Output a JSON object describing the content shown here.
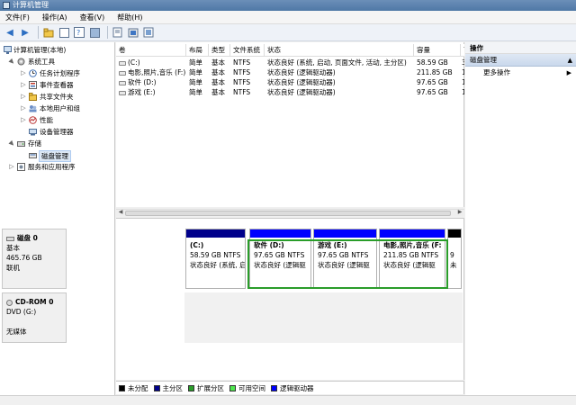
{
  "window": {
    "title": "计算机管理"
  },
  "menu": [
    "文件(F)",
    "操作(A)",
    "查看(V)",
    "帮助(H)"
  ],
  "tree": [
    {
      "label": "计算机管理(本地)",
      "indent": 0,
      "expander": "",
      "icon": "computer-icon"
    },
    {
      "label": "系统工具",
      "indent": 1,
      "expander": "▲",
      "icon": "tools-icon"
    },
    {
      "label": "任务计划程序",
      "indent": 2,
      "expander": "▷",
      "icon": "clock-icon"
    },
    {
      "label": "事件查看器",
      "indent": 2,
      "expander": "▷",
      "icon": "event-icon"
    },
    {
      "label": "共享文件夹",
      "indent": 2,
      "expander": "▷",
      "icon": "folder-icon"
    },
    {
      "label": "本地用户和组",
      "indent": 2,
      "expander": "▷",
      "icon": "users-icon"
    },
    {
      "label": "性能",
      "indent": 2,
      "expander": "▷",
      "icon": "performance-icon"
    },
    {
      "label": "设备管理器",
      "indent": 2,
      "expander": "",
      "icon": "device-icon"
    },
    {
      "label": "存储",
      "indent": 1,
      "expander": "▲",
      "icon": "storage-icon"
    },
    {
      "label": "磁盘管理",
      "indent": 2,
      "expander": "",
      "icon": "disk-icon",
      "selected": true
    },
    {
      "label": "服务和应用程序",
      "indent": 1,
      "expander": "▷",
      "icon": "services-icon"
    }
  ],
  "volumes": {
    "headers": [
      "卷",
      "布局",
      "类型",
      "文件系统",
      "状态",
      "容量",
      "可"
    ],
    "rows": [
      [
        "(C:)",
        "简单",
        "基本",
        "NTFS",
        "状态良好 (系统, 启动, 页面文件, 活动, 主分区)",
        "58.59 GB",
        "3"
      ],
      [
        "电影,照片,音乐 (F:)",
        "简单",
        "基本",
        "NTFS",
        "状态良好 (逻辑驱动器)",
        "211.85 GB",
        "1"
      ],
      [
        "软件 (D:)",
        "简单",
        "基本",
        "NTFS",
        "状态良好 (逻辑驱动器)",
        "97.65 GB",
        "1"
      ],
      [
        "游戏 (E:)",
        "简单",
        "基本",
        "NTFS",
        "状态良好 (逻辑驱动器)",
        "97.65 GB",
        "1"
      ]
    ]
  },
  "disks": [
    {
      "name": "磁盘 0",
      "lines": [
        "基本",
        "465.76 GB",
        "联机"
      ]
    },
    {
      "name": "CD-ROM 0",
      "lines": [
        "DVD (G:)",
        "",
        "无媒体"
      ]
    }
  ],
  "partitions": [
    {
      "name": "(C:)",
      "size": "58.59 GB NTFS",
      "status": "状态良好 (系统, 启",
      "bar_color": "#00008b"
    },
    {
      "name": "软件  (D:)",
      "size": "97.65 GB NTFS",
      "status": "状态良好 (逻辑驱",
      "bar_color": "#0000ff"
    },
    {
      "name": "游戏  (E:)",
      "size": "97.65 GB NTFS",
      "status": "状态良好 (逻辑驱",
      "bar_color": "#0000ff"
    },
    {
      "name": "电影,照片,音乐  (F:",
      "size": "211.85 GB NTFS",
      "status": "状态良好 (逻辑驱",
      "bar_color": "#0000ff"
    },
    {
      "name": "",
      "size": "9",
      "status": "未",
      "bar_color": "#000000"
    }
  ],
  "legend": [
    {
      "label": "未分配",
      "color": "#000000"
    },
    {
      "label": "主分区",
      "color": "#00008b"
    },
    {
      "label": "扩展分区",
      "color": "#2a9d2a"
    },
    {
      "label": "可用空间",
      "color": "#4ee64e"
    },
    {
      "label": "逻辑驱动器",
      "color": "#0000ff"
    }
  ],
  "actions": {
    "title": "操作",
    "section": "磁盘管理",
    "more": "更多操作"
  }
}
